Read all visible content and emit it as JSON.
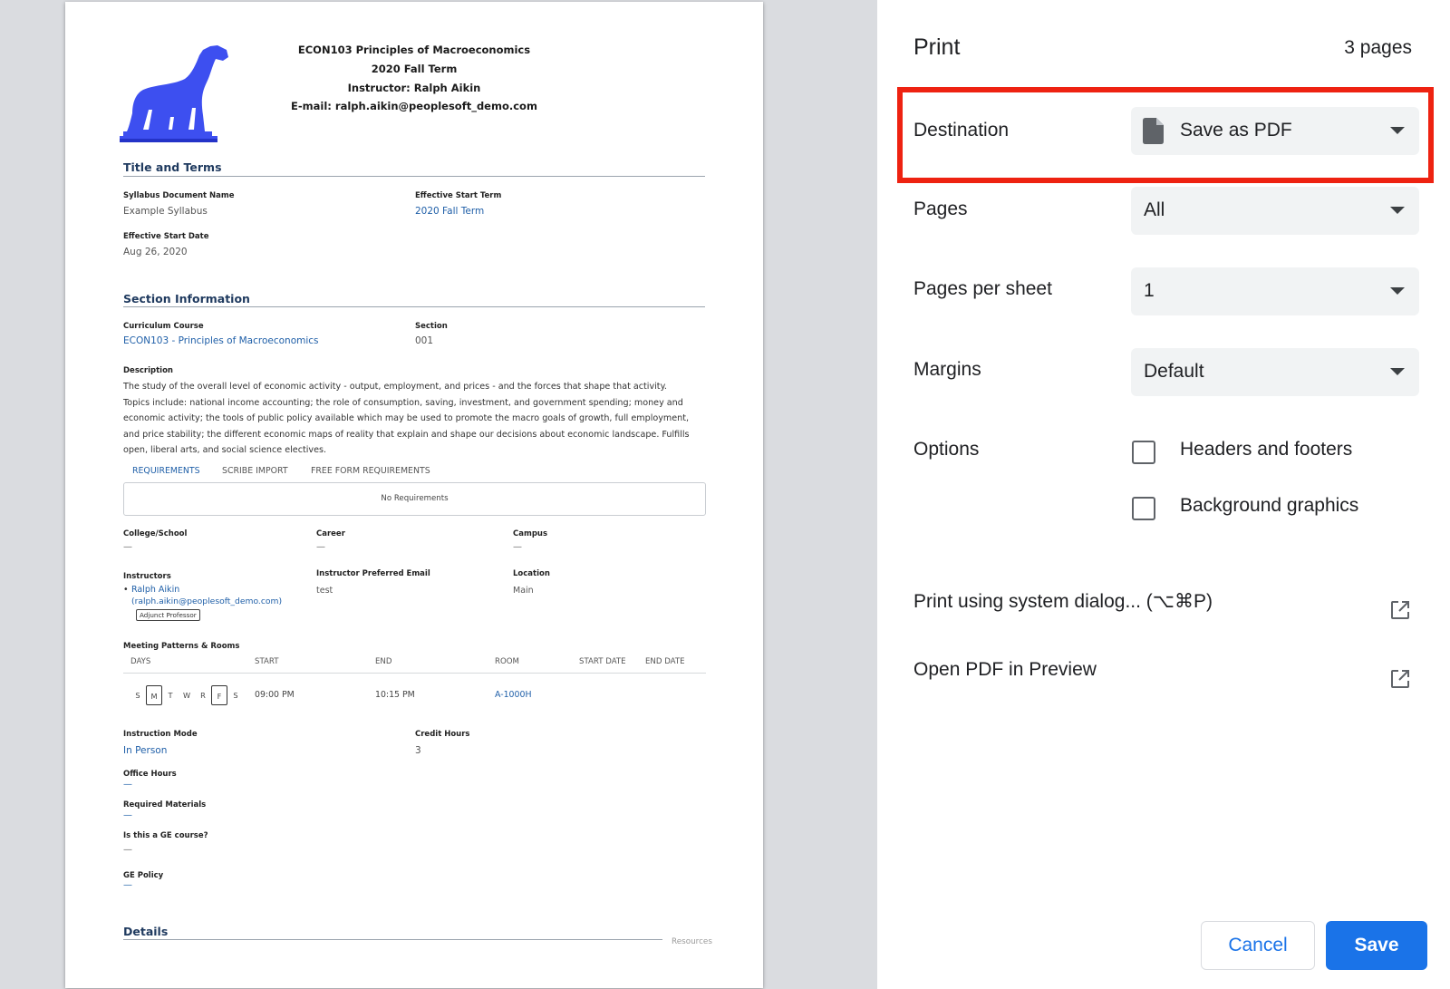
{
  "document": {
    "header_lines": [
      "ECON103 Principles of Macroeconomics",
      "2020 Fall Term",
      "Instructor: Ralph Aikin",
      "E-mail: ralph.aikin@peoplesoft_demo.com"
    ],
    "title_terms": {
      "heading": "Title and Terms",
      "doc_name_label": "Syllabus Document Name",
      "doc_name_value": "Example Syllabus",
      "start_term_label": "Effective Start Term",
      "start_term_value": "2020 Fall Term",
      "start_date_label": "Effective Start Date",
      "start_date_value": "Aug 26, 2020"
    },
    "section_info": {
      "heading": "Section Information",
      "course_label": "Curriculum Course",
      "course_value": "ECON103 - Principles of Macroeconomics",
      "section_label": "Section",
      "section_value": "001",
      "description_label": "Description",
      "description": "The study of the overall level of economic activity - output, employment, and prices - and the forces that shape that activity. Topics include: national income accounting; the role of consumption, saving, investment, and government spending; money and economic activity; the tools of public policy available which may be used to promote the macro goals of growth, full employment, and price stability; the different economic maps of reality that explain and shape our decisions about economic landscape. Fulfills open, liberal arts, and social science electives."
    },
    "requirements": {
      "tabs": [
        "REQUIREMENTS",
        "SCRIBE IMPORT",
        "FREE FORM REQUIREMENTS"
      ],
      "empty_text": "No Requirements"
    },
    "org": {
      "college_label": "College/School",
      "college_value": "—",
      "career_label": "Career",
      "career_value": "—",
      "campus_label": "Campus",
      "campus_value": "—",
      "instructors_label": "Instructors",
      "instructor_bullet": "•",
      "instructor_name": "Ralph Aikin",
      "instructor_email": "(ralph.aikin@peoplesoft_demo.com)",
      "instructor_badge": "Adjunct Professor",
      "pref_email_label": "Instructor Preferred Email",
      "pref_email_value": "test",
      "location_label": "Location",
      "location_value": "Main"
    },
    "meeting": {
      "label": "Meeting Patterns & Rooms",
      "columns": [
        "DAYS",
        "START",
        "END",
        "ROOM",
        "START DATE",
        "END DATE"
      ],
      "days": [
        "S",
        "M",
        "T",
        "W",
        "R",
        "F",
        "S"
      ],
      "selected_days": [
        "M",
        "F"
      ],
      "start": "09:00 PM",
      "end": "10:15 PM",
      "room": "A-1000H"
    },
    "instruction": {
      "mode_label": "Instruction Mode",
      "mode_value": "In Person",
      "credit_label": "Credit Hours",
      "credit_value": "3",
      "office_label": "Office Hours",
      "office_value": "—",
      "materials_label": "Required Materials",
      "materials_value": "—",
      "ge_label": "Is this a GE course?",
      "ge_value": "—",
      "ge_policy_label": "GE Policy",
      "ge_policy_value": "—"
    },
    "details": {
      "heading": "Details",
      "resources_label": "Resources"
    },
    "logo_color": "#3d4ff0"
  },
  "print_panel": {
    "title": "Print",
    "page_count": "3 pages",
    "destination_label": "Destination",
    "destination_value": "Save as PDF",
    "destination_icon": "file-icon",
    "pages_label": "Pages",
    "pages_value": "All",
    "pages_per_sheet_label": "Pages per sheet",
    "pages_per_sheet_value": "1",
    "margins_label": "Margins",
    "margins_value": "Default",
    "options_label": "Options",
    "option_headers_footers": "Headers and footers",
    "option_headers_footers_checked": false,
    "option_background_graphics": "Background graphics",
    "option_background_graphics_checked": false,
    "system_dialog_link": "Print using system dialog... (⌥⌘P)",
    "open_preview_link": "Open PDF in Preview",
    "cancel_label": "Cancel",
    "save_label": "Save",
    "highlight_color": "#ee2211",
    "accent_color": "#1a73e8"
  }
}
